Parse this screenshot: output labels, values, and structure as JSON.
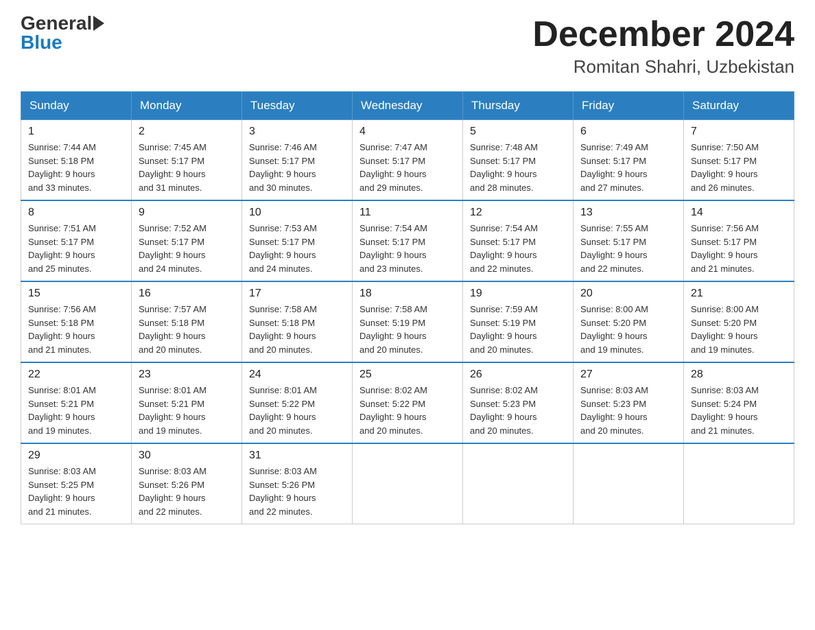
{
  "logo": {
    "general": "General",
    "blue": "Blue"
  },
  "title": "December 2024",
  "location": "Romitan Shahri, Uzbekistan",
  "days_of_week": [
    "Sunday",
    "Monday",
    "Tuesday",
    "Wednesday",
    "Thursday",
    "Friday",
    "Saturday"
  ],
  "weeks": [
    [
      {
        "num": "1",
        "sunrise": "7:44 AM",
        "sunset": "5:18 PM",
        "daylight": "9 hours and 33 minutes."
      },
      {
        "num": "2",
        "sunrise": "7:45 AM",
        "sunset": "5:17 PM",
        "daylight": "9 hours and 31 minutes."
      },
      {
        "num": "3",
        "sunrise": "7:46 AM",
        "sunset": "5:17 PM",
        "daylight": "9 hours and 30 minutes."
      },
      {
        "num": "4",
        "sunrise": "7:47 AM",
        "sunset": "5:17 PM",
        "daylight": "9 hours and 29 minutes."
      },
      {
        "num": "5",
        "sunrise": "7:48 AM",
        "sunset": "5:17 PM",
        "daylight": "9 hours and 28 minutes."
      },
      {
        "num": "6",
        "sunrise": "7:49 AM",
        "sunset": "5:17 PM",
        "daylight": "9 hours and 27 minutes."
      },
      {
        "num": "7",
        "sunrise": "7:50 AM",
        "sunset": "5:17 PM",
        "daylight": "9 hours and 26 minutes."
      }
    ],
    [
      {
        "num": "8",
        "sunrise": "7:51 AM",
        "sunset": "5:17 PM",
        "daylight": "9 hours and 25 minutes."
      },
      {
        "num": "9",
        "sunrise": "7:52 AM",
        "sunset": "5:17 PM",
        "daylight": "9 hours and 24 minutes."
      },
      {
        "num": "10",
        "sunrise": "7:53 AM",
        "sunset": "5:17 PM",
        "daylight": "9 hours and 24 minutes."
      },
      {
        "num": "11",
        "sunrise": "7:54 AM",
        "sunset": "5:17 PM",
        "daylight": "9 hours and 23 minutes."
      },
      {
        "num": "12",
        "sunrise": "7:54 AM",
        "sunset": "5:17 PM",
        "daylight": "9 hours and 22 minutes."
      },
      {
        "num": "13",
        "sunrise": "7:55 AM",
        "sunset": "5:17 PM",
        "daylight": "9 hours and 22 minutes."
      },
      {
        "num": "14",
        "sunrise": "7:56 AM",
        "sunset": "5:17 PM",
        "daylight": "9 hours and 21 minutes."
      }
    ],
    [
      {
        "num": "15",
        "sunrise": "7:56 AM",
        "sunset": "5:18 PM",
        "daylight": "9 hours and 21 minutes."
      },
      {
        "num": "16",
        "sunrise": "7:57 AM",
        "sunset": "5:18 PM",
        "daylight": "9 hours and 20 minutes."
      },
      {
        "num": "17",
        "sunrise": "7:58 AM",
        "sunset": "5:18 PM",
        "daylight": "9 hours and 20 minutes."
      },
      {
        "num": "18",
        "sunrise": "7:58 AM",
        "sunset": "5:19 PM",
        "daylight": "9 hours and 20 minutes."
      },
      {
        "num": "19",
        "sunrise": "7:59 AM",
        "sunset": "5:19 PM",
        "daylight": "9 hours and 20 minutes."
      },
      {
        "num": "20",
        "sunrise": "8:00 AM",
        "sunset": "5:20 PM",
        "daylight": "9 hours and 19 minutes."
      },
      {
        "num": "21",
        "sunrise": "8:00 AM",
        "sunset": "5:20 PM",
        "daylight": "9 hours and 19 minutes."
      }
    ],
    [
      {
        "num": "22",
        "sunrise": "8:01 AM",
        "sunset": "5:21 PM",
        "daylight": "9 hours and 19 minutes."
      },
      {
        "num": "23",
        "sunrise": "8:01 AM",
        "sunset": "5:21 PM",
        "daylight": "9 hours and 19 minutes."
      },
      {
        "num": "24",
        "sunrise": "8:01 AM",
        "sunset": "5:22 PM",
        "daylight": "9 hours and 20 minutes."
      },
      {
        "num": "25",
        "sunrise": "8:02 AM",
        "sunset": "5:22 PM",
        "daylight": "9 hours and 20 minutes."
      },
      {
        "num": "26",
        "sunrise": "8:02 AM",
        "sunset": "5:23 PM",
        "daylight": "9 hours and 20 minutes."
      },
      {
        "num": "27",
        "sunrise": "8:03 AM",
        "sunset": "5:23 PM",
        "daylight": "9 hours and 20 minutes."
      },
      {
        "num": "28",
        "sunrise": "8:03 AM",
        "sunset": "5:24 PM",
        "daylight": "9 hours and 21 minutes."
      }
    ],
    [
      {
        "num": "29",
        "sunrise": "8:03 AM",
        "sunset": "5:25 PM",
        "daylight": "9 hours and 21 minutes."
      },
      {
        "num": "30",
        "sunrise": "8:03 AM",
        "sunset": "5:26 PM",
        "daylight": "9 hours and 22 minutes."
      },
      {
        "num": "31",
        "sunrise": "8:03 AM",
        "sunset": "5:26 PM",
        "daylight": "9 hours and 22 minutes."
      },
      null,
      null,
      null,
      null
    ]
  ]
}
